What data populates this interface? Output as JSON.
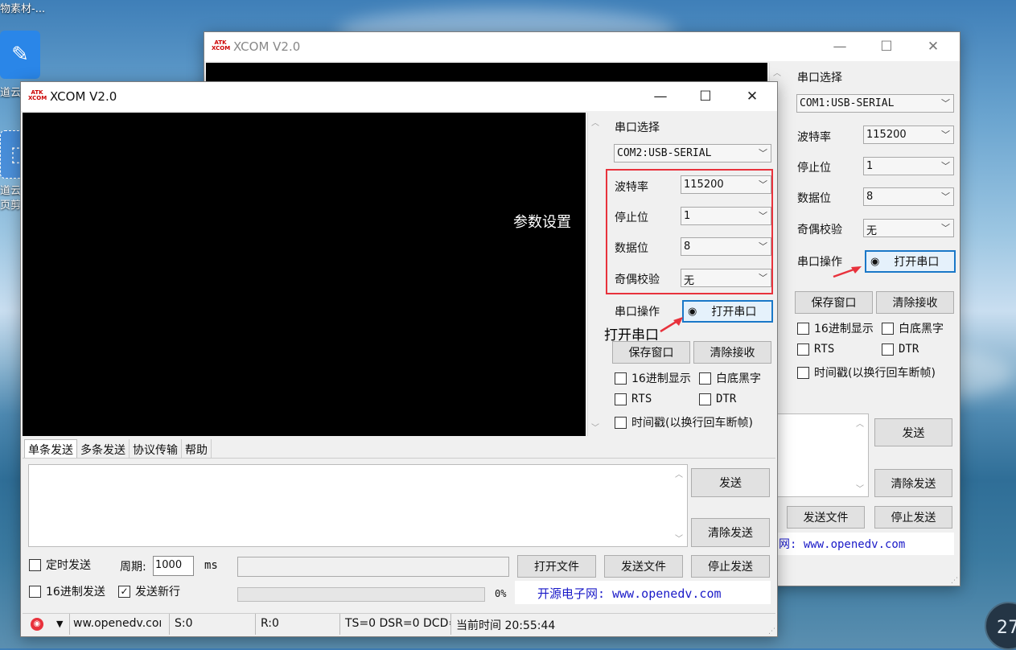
{
  "desktop": {
    "top_text": "物素材-...",
    "icon1_text": "道云",
    "icon2_text1": "道云笔",
    "icon2_text2": "页剪",
    "clock": "27"
  },
  "back": {
    "title": "XCOM V2.0",
    "serial_label": "串口选择",
    "port": "COM1:USB-SERIAL",
    "baud_label": "波特率",
    "baud": "115200",
    "stop_label": "停止位",
    "stop": "1",
    "data_label": "数据位",
    "data": "8",
    "parity_label": "奇偶校验",
    "parity": "无",
    "op_label": "串口操作",
    "open_btn": "打开串口",
    "save_btn": "保存窗口",
    "clear_btn": "清除接收",
    "hex_display": "16进制显示",
    "white_bg": "白底黑字",
    "rts": "RTS",
    "dtr": "DTR",
    "timestamp": "时间戳(以换行回车断帧)",
    "send_btn": "发送",
    "clear_send_btn": "清除发送",
    "send_file_btn": "发送文件",
    "stop_send_btn": "停止发送",
    "website": "网: www.openedv.com"
  },
  "front": {
    "title": "XCOM V2.0",
    "serial_label": "串口选择",
    "port": "COM2:USB-SERIAL",
    "baud_label": "波特率",
    "baud": "115200",
    "stop_label": "停止位",
    "stop": "1",
    "data_label": "数据位",
    "data": "8",
    "parity_label": "奇偶校验",
    "parity": "无",
    "op_label": "串口操作",
    "open_btn": "打开串口",
    "save_btn": "保存窗口",
    "clear_btn": "清除接收",
    "hex_display": "16进制显示",
    "white_bg": "白底黑字",
    "rts": "RTS",
    "dtr": "DTR",
    "timestamp": "时间戳(以换行回车断帧)",
    "tabs": [
      "单条发送",
      "多条发送",
      "协议传输",
      "帮助"
    ],
    "send_btn": "发送",
    "clear_send_btn": "清除发送",
    "timed_send": "定时发送",
    "period_label": "周期:",
    "period": "1000",
    "ms": "ms",
    "open_file_btn": "打开文件",
    "send_file_btn": "发送文件",
    "stop_send_btn": "停止发送",
    "hex_send": "16进制发送",
    "send_newline": "发送新行",
    "progress": "0%",
    "website": "开源电子网: www.openedv.com",
    "status": {
      "url": "ww.openedv.coı",
      "s": "S:0",
      "r": "R:0",
      "lines": "TS=0 DSR=0 DCD=",
      "time": "当前时间 20:55:44"
    }
  },
  "annotations": {
    "params": "参数设置",
    "open": "打开串口"
  },
  "colors": {
    "highlight": "#e8323c",
    "accent": "#1a78c8",
    "link": "#1a1ac8"
  }
}
